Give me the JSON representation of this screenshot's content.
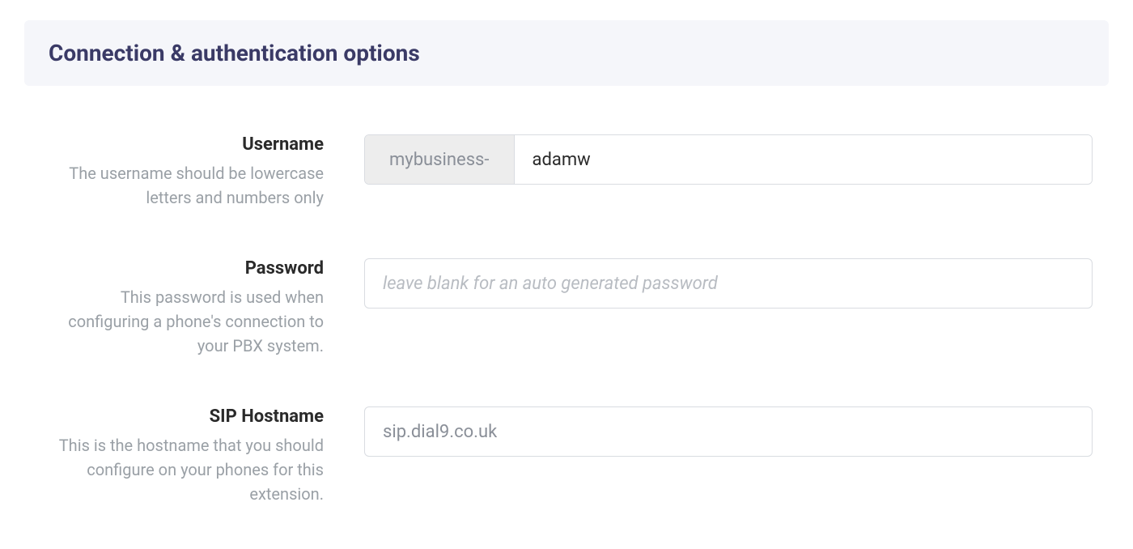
{
  "section": {
    "title": "Connection & authentication options"
  },
  "fields": {
    "username": {
      "label": "Username",
      "help": "The username should be lowercase letters and numbers only",
      "prefix": "mybusiness-",
      "value": "adamw"
    },
    "password": {
      "label": "Password",
      "help": "This password is used when configuring a phone's connection to your PBX system.",
      "placeholder": "leave blank for an auto generated password",
      "value": ""
    },
    "sip_hostname": {
      "label": "SIP Hostname",
      "help": "This is the hostname that you should configure on your phones for this extension.",
      "value": "sip.dial9.co.uk"
    }
  }
}
